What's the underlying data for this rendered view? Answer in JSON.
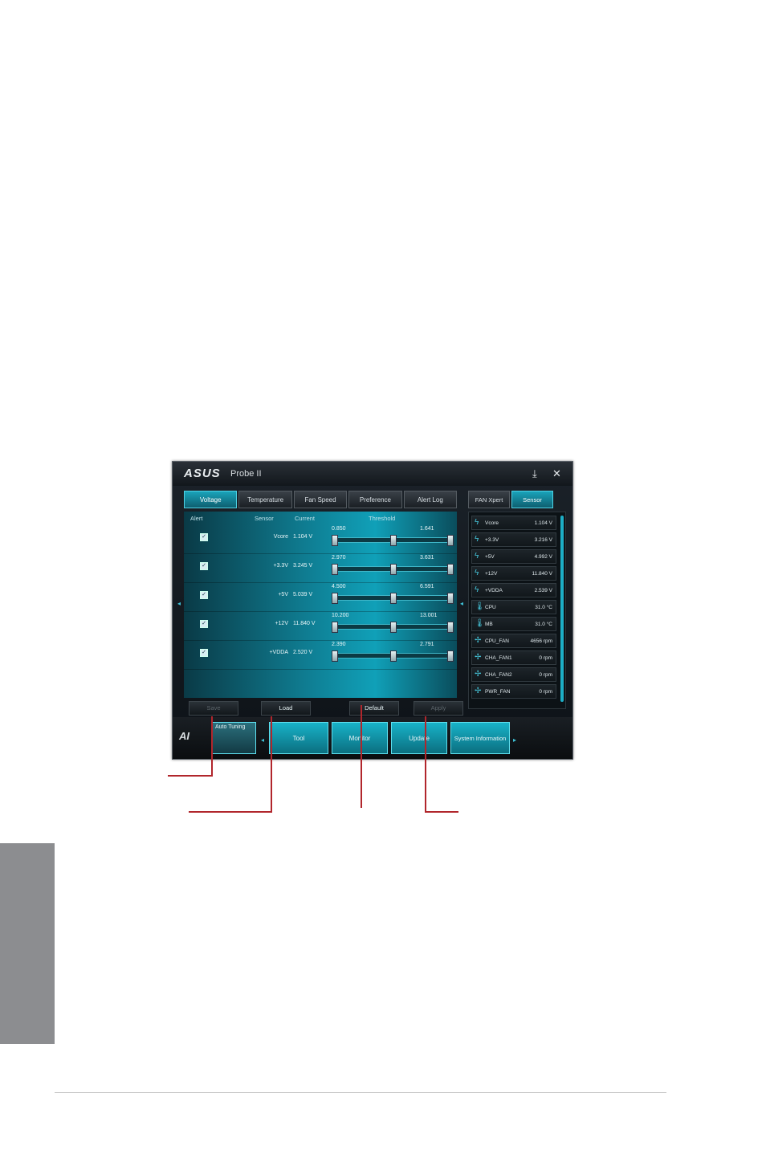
{
  "window": {
    "logo": "ASUS",
    "title": "Probe II",
    "minimize_icon": "download-icon",
    "close_icon": "close-icon"
  },
  "tabs": [
    "Voltage",
    "Temperature",
    "Fan Speed",
    "Preference",
    "Alert Log"
  ],
  "active_tab": "Voltage",
  "columns": {
    "alert": "Alert",
    "sensor": "Sensor",
    "current": "Current",
    "threshold": "Threshold"
  },
  "rows": [
    {
      "sensor": "Vcore",
      "current": "1.104 V",
      "low": "0.850",
      "high": "1.641",
      "level": 0.5
    },
    {
      "sensor": "+3.3V",
      "current": "3.245 V",
      "low": "2.970",
      "high": "3.631",
      "level": 0.5
    },
    {
      "sensor": "+5V",
      "current": "5.039 V",
      "low": "4.500",
      "high": "6.591",
      "level": 0.5
    },
    {
      "sensor": "+12V",
      "current": "11.840 V",
      "low": "10.200",
      "high": "13.001",
      "level": 0.5
    },
    {
      "sensor": "+VDDA",
      "current": "2.520 V",
      "low": "2.390",
      "high": "2.791",
      "level": 0.5
    }
  ],
  "actions": {
    "save": "Save",
    "load": "Load",
    "default": "Default",
    "apply": "Apply"
  },
  "right_tabs": [
    "FAN Xpert",
    "Sensor"
  ],
  "right_active": "Sensor",
  "sensor_list": [
    {
      "icon": "lightning-icon",
      "name": "Vcore",
      "value": "1.104 V"
    },
    {
      "icon": "lightning-icon",
      "name": "+3.3V",
      "value": "3.216 V"
    },
    {
      "icon": "lightning-icon",
      "name": "+5V",
      "value": "4.992 V"
    },
    {
      "icon": "lightning-icon",
      "name": "+12V",
      "value": "11.840 V"
    },
    {
      "icon": "lightning-icon",
      "name": "+VDDA",
      "value": "2.539 V"
    },
    {
      "icon": "thermometer-icon",
      "name": "CPU",
      "value": "31.0 °C"
    },
    {
      "icon": "thermometer-icon",
      "name": "MB",
      "value": "31.0 °C"
    },
    {
      "icon": "fan-icon",
      "name": "CPU_FAN",
      "value": "4656 rpm"
    },
    {
      "icon": "fan-icon",
      "name": "CHA_FAN1",
      "value": "0 rpm"
    },
    {
      "icon": "fan-icon",
      "name": "CHA_FAN2",
      "value": "0 rpm"
    },
    {
      "icon": "fan-icon",
      "name": "PWR_FAN",
      "value": "0 rpm"
    }
  ],
  "nav": {
    "logo": "AI",
    "auto_tuning": "Auto Tuning",
    "items": [
      "Tool",
      "Monitor",
      "Update",
      "System Information"
    ]
  }
}
